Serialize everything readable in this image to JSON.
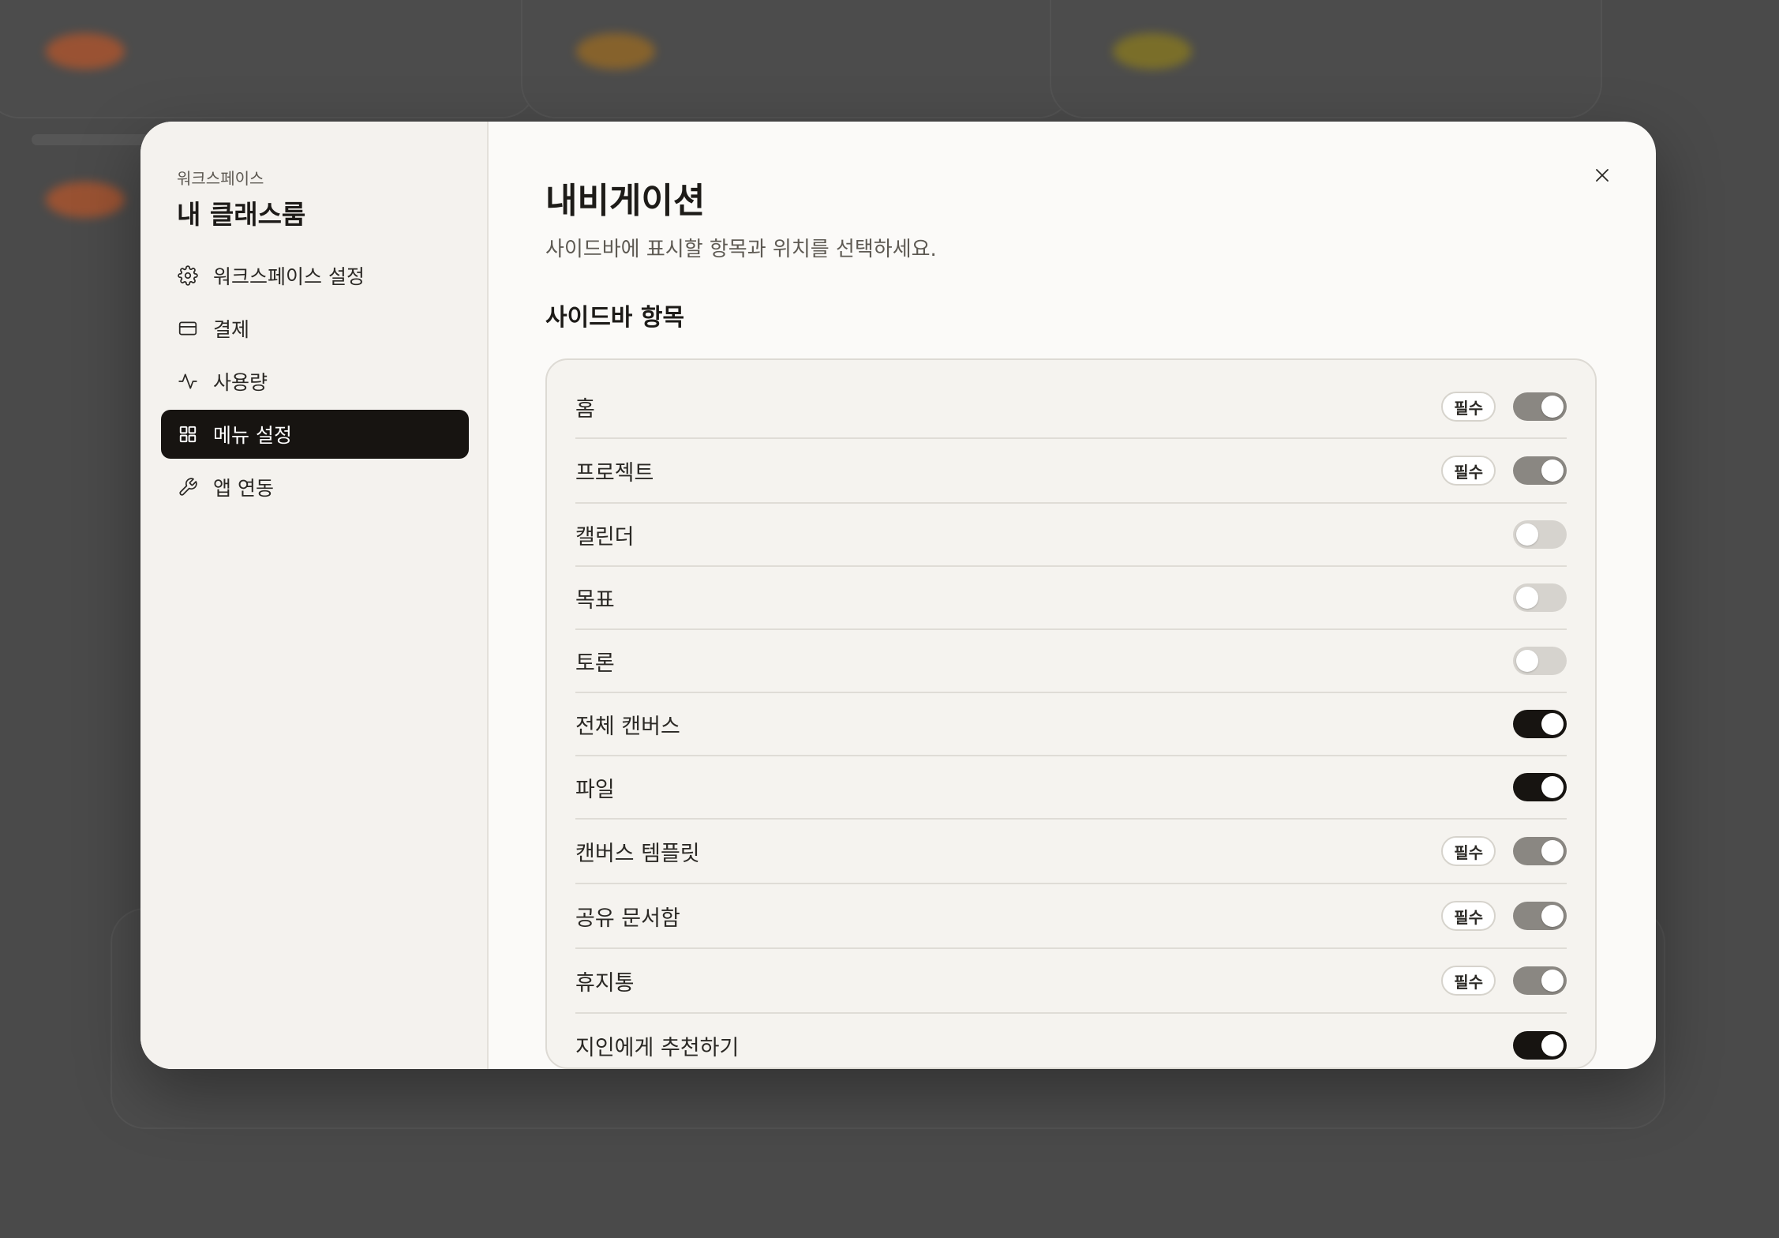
{
  "workspace": {
    "label": "워크스페이스",
    "name": "내 클래스룸"
  },
  "nav": {
    "items": [
      {
        "label": "워크스페이스 설정",
        "icon": "gear-icon",
        "active": false
      },
      {
        "label": "결제",
        "icon": "credit-card-icon",
        "active": false
      },
      {
        "label": "사용량",
        "icon": "activity-icon",
        "active": false
      },
      {
        "label": "메뉴 설정",
        "icon": "grid-icon",
        "active": true
      },
      {
        "label": "앱 연동",
        "icon": "wrench-icon",
        "active": false
      }
    ]
  },
  "main": {
    "title": "내비게이션",
    "description": "사이드바에 표시할 항목과 위치를 선택하세요.",
    "section_title": "사이드바 항목",
    "required_badge": "필수",
    "items": [
      {
        "label": "홈",
        "required": true,
        "enabled": true
      },
      {
        "label": "프로젝트",
        "required": true,
        "enabled": true
      },
      {
        "label": "캘린더",
        "required": false,
        "enabled": false
      },
      {
        "label": "목표",
        "required": false,
        "enabled": false
      },
      {
        "label": "토론",
        "required": false,
        "enabled": false
      },
      {
        "label": "전체 캔버스",
        "required": false,
        "enabled": true
      },
      {
        "label": "파일",
        "required": false,
        "enabled": true
      },
      {
        "label": "캔버스 템플릿",
        "required": true,
        "enabled": true
      },
      {
        "label": "공유 문서함",
        "required": true,
        "enabled": true
      },
      {
        "label": "휴지통",
        "required": true,
        "enabled": true
      },
      {
        "label": "지인에게 추천하기",
        "required": false,
        "enabled": true
      }
    ]
  },
  "colors": {
    "active_nav_bg": "#171411",
    "toggle_on": "#171411",
    "toggle_locked": "#8a8782",
    "toggle_off": "#d6d3ce",
    "backdrop": "#474747"
  }
}
